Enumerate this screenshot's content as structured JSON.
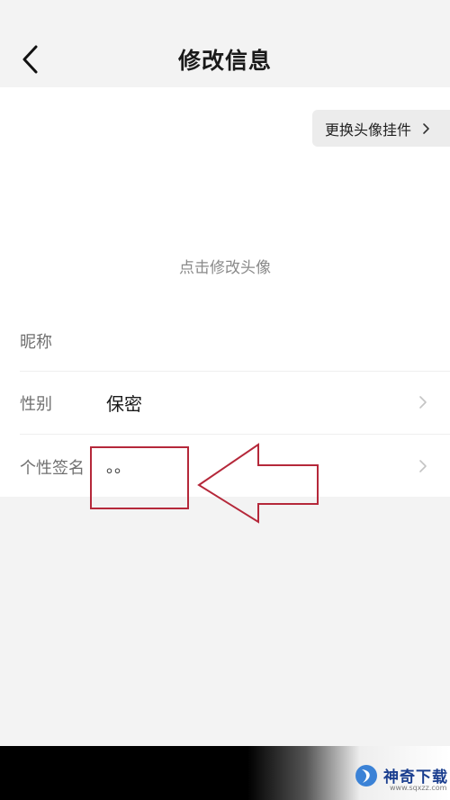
{
  "header": {
    "title": "修改信息",
    "back_icon": "chevron-left-icon"
  },
  "avatar": {
    "pendant_label": "更换头像挂件",
    "pendant_chevron": "›",
    "hint": "点击修改头像"
  },
  "fields": {
    "nickname": {
      "label": "昵称",
      "value": ""
    },
    "gender": {
      "label": "性别",
      "value": "保密"
    },
    "signature": {
      "label": "个性签名",
      "value": "。。"
    }
  },
  "annotation": {
    "color": "#b5283a"
  },
  "watermark": {
    "text": "神奇下载",
    "url": "www.sqxzz.com"
  }
}
